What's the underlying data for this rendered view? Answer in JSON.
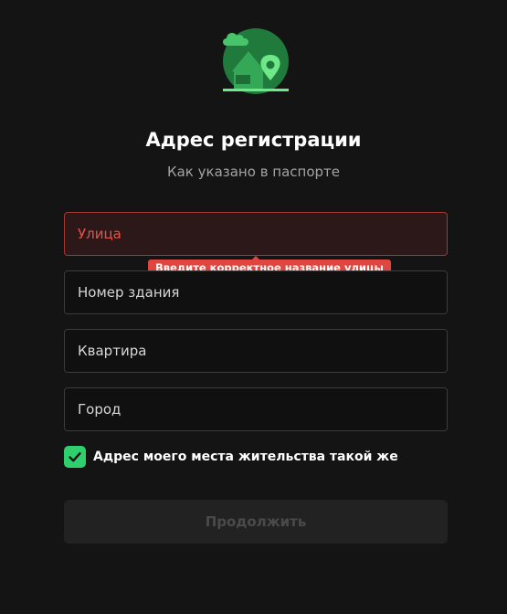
{
  "header": {
    "title": "Адрес регистрации",
    "subtitle": "Как указано в паспорте"
  },
  "form": {
    "fields": [
      {
        "label": "Улица",
        "state": "error"
      },
      {
        "label": "Номер здания",
        "state": "normal"
      },
      {
        "label": "Квартира",
        "state": "normal"
      },
      {
        "label": "Город",
        "state": "normal"
      }
    ],
    "street_error": "Введите корректное название улицы",
    "same_address": {
      "label": "Адрес моего места жительства такой же",
      "checked": true
    },
    "continue_label": "Продолжить",
    "continue_enabled": false
  },
  "colors": {
    "background": "#141414",
    "accent_green": "#2fcf6e",
    "error_red": "#e0463f"
  },
  "icons": {
    "illustration": "house-location-illustration",
    "checkbox": "checkmark-icon"
  }
}
